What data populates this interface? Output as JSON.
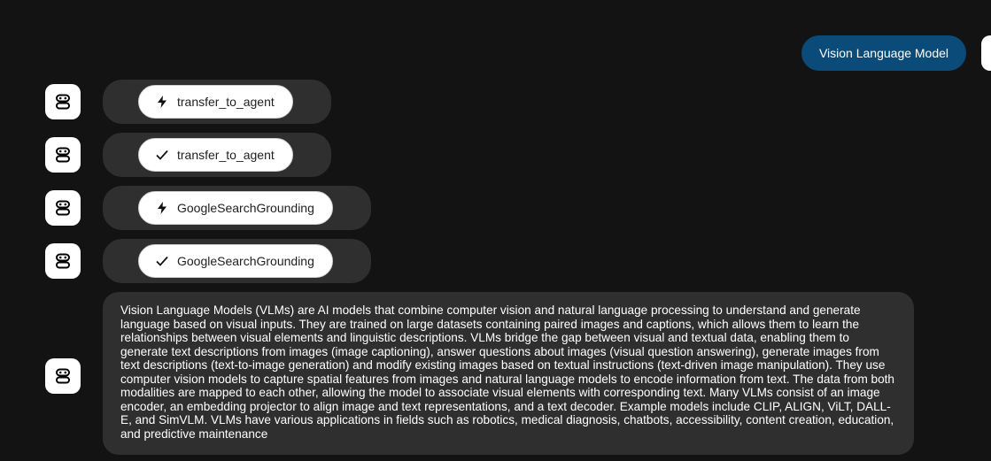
{
  "user_message": {
    "text": "Vision Language Model",
    "bubble_color": "#0b4b7a"
  },
  "tool_calls": [
    {
      "icon": "bolt-icon",
      "label": "transfer_to_agent"
    },
    {
      "icon": "check-icon",
      "label": "transfer_to_agent"
    },
    {
      "icon": "bolt-icon",
      "label": "GoogleSearchGrounding"
    },
    {
      "icon": "check-icon",
      "label": "GoogleSearchGrounding"
    }
  ],
  "agent_response": {
    "text": "Vision Language Models (VLMs) are AI models that combine computer vision and natural language processing to understand and generate language based on visual inputs. They are trained on large datasets containing paired images and captions, which allows them to learn the relationships between visual elements and linguistic descriptions. VLMs bridge the gap between visual and textual data, enabling them to generate text descriptions from images (image captioning), answer questions about images (visual question answering), generate images from text descriptions (text-to-image generation) and modify existing images based on textual instructions (text-driven image manipulation). They use computer vision models to capture spatial features from images and natural language models to encode information from text. The data from both modalities are mapped to each other, allowing the model to associate visual elements with corresponding text. Many VLMs consist of an image encoder, an embedding projector to align image and text representations, and a text decoder. Example models include CLIP, ALIGN, ViLT, DALL-E, and SimVLM. VLMs have various applications in fields such as robotics, medical diagnosis, chatbots, accessibility, content creation, education, and predictive maintenance"
  },
  "colors": {
    "background": "#131313",
    "bubble": "#2f2f2f",
    "chip": "#ffffff",
    "avatar": "#ffffff"
  }
}
